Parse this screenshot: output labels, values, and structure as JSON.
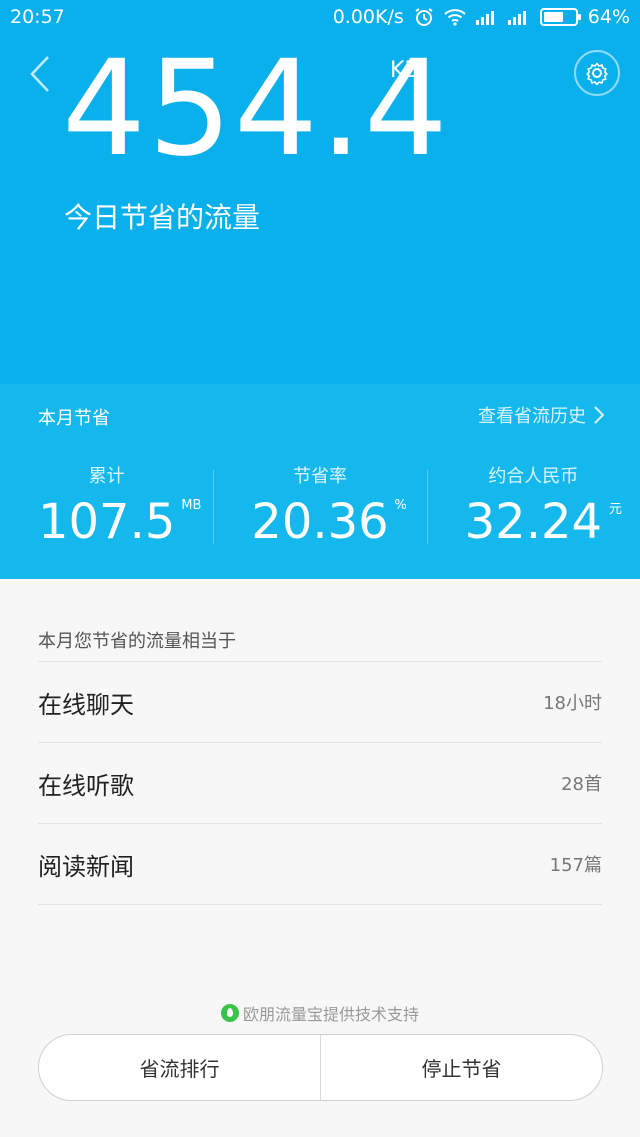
{
  "status_bar": {
    "time": "20:57",
    "net_speed": "0.00K/s",
    "battery": "64%",
    "battery_level": 0.64,
    "icons": [
      "alarm-icon",
      "wifi-icon",
      "signal-icon",
      "signal-icon",
      "battery-icon"
    ]
  },
  "hero": {
    "value": "454.4",
    "unit": "KB",
    "caption": "今日节省的流量",
    "background": "#0ab0eb"
  },
  "month": {
    "title": "本月节省",
    "history_link": "查看省流历史",
    "background": "#14b8ec",
    "stats": [
      {
        "label": "累计",
        "value": "107.5",
        "unit": "MB"
      },
      {
        "label": "节省率",
        "value": "20.36",
        "unit": "%"
      },
      {
        "label": "约合人民币",
        "value": "32.24",
        "unit": "元"
      }
    ]
  },
  "equivalent": {
    "heading": "本月您节省的流量相当于",
    "items": [
      {
        "name": "在线聊天",
        "value": "18小时"
      },
      {
        "name": "在线听歌",
        "value": "28首"
      },
      {
        "name": "阅读新闻",
        "value": "157篇"
      }
    ]
  },
  "footer": {
    "powered_by": "欧朋流量宝提供技术支持",
    "buttons": {
      "ranking": "省流排行",
      "stop": "停止节省"
    }
  }
}
